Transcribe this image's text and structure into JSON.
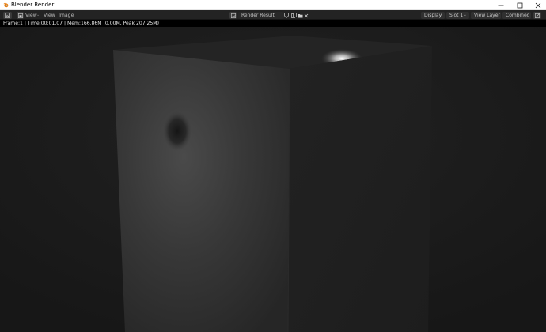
{
  "window": {
    "title": "Blender Render",
    "controls": [
      "minimize-icon",
      "maximize-icon",
      "close-icon"
    ]
  },
  "header": {
    "menus": [
      "View",
      "Image"
    ],
    "image_name": "Render Result",
    "dropdowns": {
      "display": "Display",
      "slot": "Slot 1",
      "layer": "View Layer",
      "pass": "Combined"
    }
  },
  "info": {
    "text": "Frame:1 | Time:00:01.07 | Mem:166.86M (0.00M, Peak 207.25M)"
  },
  "colors": {
    "accent": "#e87d0d",
    "header_bg": "#232323",
    "info_bg": "#000000",
    "viewport_bg": "#1c1c1c"
  }
}
